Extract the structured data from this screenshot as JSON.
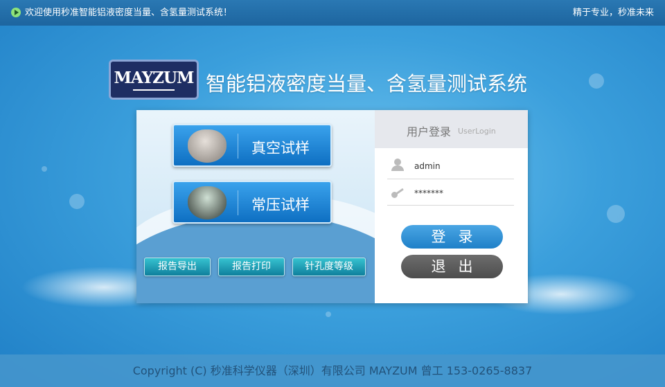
{
  "topbar": {
    "welcome": "欢迎使用秒准智能铝液密度当量、含氢量测试系统！",
    "slogan": "精于专业，秒准未来",
    "play_icon": "play-circle-icon"
  },
  "header": {
    "logo_text": "MAYZUM",
    "title": "智能铝液密度当量、含氢量测试系统"
  },
  "samples": [
    {
      "label": "真空试样"
    },
    {
      "label": "常压试样"
    }
  ],
  "actions": [
    {
      "label": "报告导出"
    },
    {
      "label": "报告打印"
    },
    {
      "label": "针孔度等级"
    }
  ],
  "login": {
    "title_zh": "用户登录",
    "title_en": "UserLogin",
    "username": "admin",
    "password": "*******",
    "login_label": "登录",
    "exit_label": "退出"
  },
  "footer": {
    "copyright": "Copyright (C) 秒准科学仪器（深圳）有限公司 MAYZUM 曾工 153-0265-8837"
  },
  "colors": {
    "background": "#3b9fdc",
    "login_button": "#2a8cd2",
    "exit_button": "#5a5a5a",
    "action_button": "#1c9ab5"
  }
}
